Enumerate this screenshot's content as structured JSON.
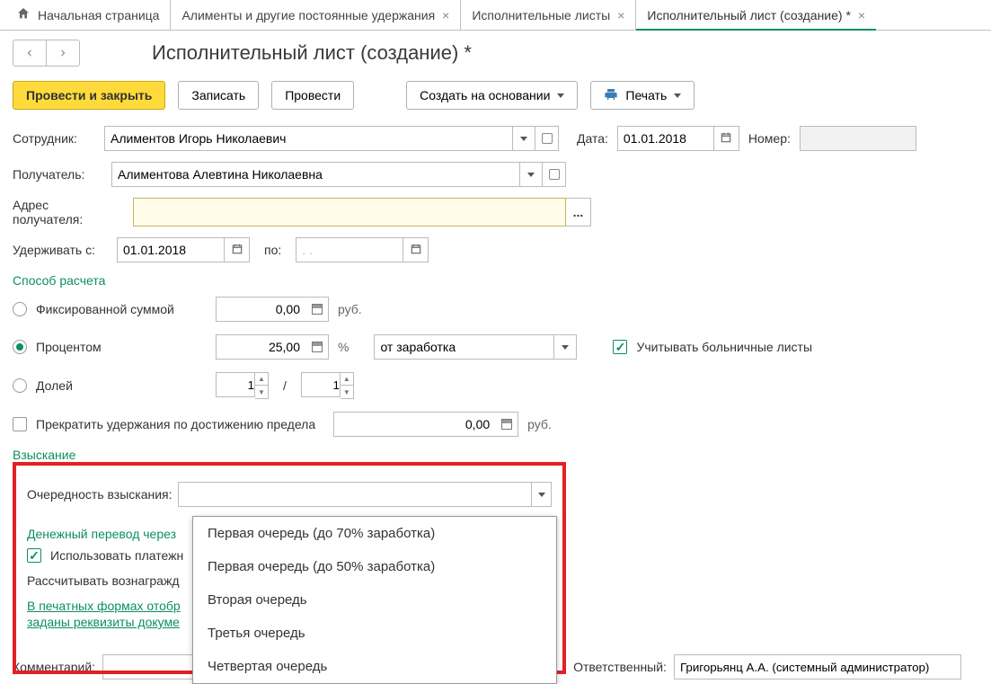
{
  "tabs": {
    "home": "Начальная страница",
    "alimony": "Алименты и другие постоянные удержания",
    "orders": "Исполнительные листы",
    "current": "Исполнительный лист (создание) *"
  },
  "page_title": "Исполнительный лист (создание) *",
  "toolbar": {
    "post_close": "Провести и закрыть",
    "save": "Записать",
    "post": "Провести",
    "create_based": "Создать на основании",
    "print": "Печать"
  },
  "labels": {
    "employee": "Сотрудник:",
    "recipient": "Получатель:",
    "recipient_addr_1": "Адрес",
    "recipient_addr_2": "получателя:",
    "withhold_from": "Удерживать с:",
    "to": "по:",
    "date": "Дата:",
    "number": "Номер:",
    "calc_method": "Способ расчета",
    "fixed": "Фиксированной суммой",
    "percent": "Процентом",
    "fraction": "Долей",
    "rub": "руб.",
    "pct": "%",
    "earnings_src": "от заработка",
    "consider_sick": "Учитывать больничные листы",
    "stop_on_limit": "Прекратить удержания по достижению предела",
    "recovery": "Взыскание",
    "priority": "Очередность взыскания:",
    "transfer": "Денежный перевод через",
    "use_agent": "Использовать платежн",
    "calc_fee": "Рассчитывать вознагражд",
    "print_forms": "В печатных формах отобр",
    "doc_fields": "заданы реквизиты докуме",
    "comment": "Комментарий:",
    "responsible": "Ответственный:"
  },
  "values": {
    "employee": "Алиментов Игорь Николаевич",
    "recipient": "Алиментова Алевтина Николаевна",
    "date": "01.01.2018",
    "number": "",
    "from_date": "01.01.2018",
    "to_date": ". .",
    "fixed_amount": "0,00",
    "percent_amount": "25,00",
    "fraction_a": "1",
    "fraction_b": "1",
    "limit": "0,00",
    "responsible": "Григорьянц А.А. (системный администратор)"
  },
  "priority_options": [
    "Первая очередь (до 70% заработка)",
    "Первая очередь (до 50% заработка)",
    "Вторая очередь",
    "Третья очередь",
    "Четвертая очередь"
  ],
  "glyphs": {
    "ellipsis": "..."
  }
}
